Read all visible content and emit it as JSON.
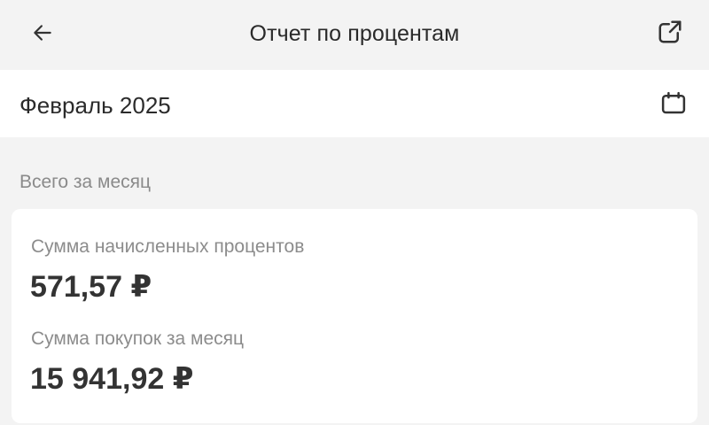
{
  "header": {
    "title": "Отчет по процентам",
    "back_icon": "arrow-left-icon",
    "share_icon": "external-link-icon"
  },
  "period": {
    "label": "Февраль 2025",
    "icon": "calendar-icon"
  },
  "summary": {
    "section_title": "Всего за месяц",
    "accrued_interest_label": "Сумма начисленных процентов",
    "accrued_interest_value": "571,57 ₽",
    "purchases_label": "Сумма покупок за месяц",
    "purchases_value": "15 941,92 ₽"
  },
  "colors": {
    "background": "#f3f3f3",
    "card": "#ffffff",
    "text_primary": "#2b2b2b",
    "text_secondary": "#8c8c8c"
  }
}
